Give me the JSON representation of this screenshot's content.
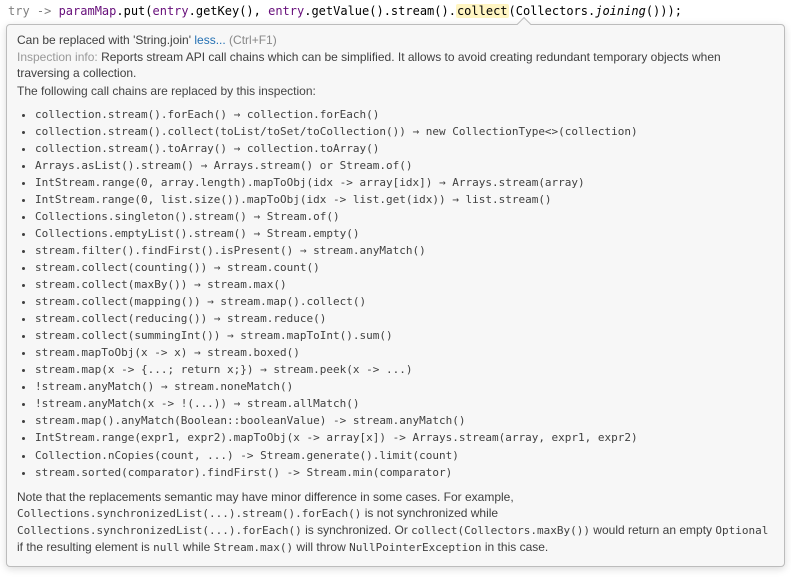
{
  "code": {
    "prefix": "try -> ",
    "paramMap": "paramMap",
    "put": ".put(",
    "entry1": "entry",
    "getKey": ".getKey(), ",
    "entry2": "entry",
    "getValue": ".getValue().stream().",
    "collect": "collect",
    "collectorsOpen": "(Collectors.",
    "joining": "joining",
    "close": "()));"
  },
  "tooltip": {
    "title": "Can be replaced with 'String.join'",
    "link": "less...",
    "shortcut": "(Ctrl+F1)",
    "inspection_label": "Inspection info:",
    "inspection_text": "Reports stream API call chains which can be simplified. It allows to avoid creating redundant temporary objects when traversing a collection.",
    "subhead": "The following call chains are replaced by this inspection:",
    "replacements": [
      "collection.stream().forEach() → collection.forEach()",
      "collection.stream().collect(toList/toSet/toCollection()) → new CollectionType<>(collection)",
      "collection.stream().toArray() → collection.toArray()",
      "Arrays.asList().stream() → Arrays.stream() or Stream.of()",
      "IntStream.range(0, array.length).mapToObj(idx -> array[idx]) → Arrays.stream(array)",
      "IntStream.range(0, list.size()).mapToObj(idx -> list.get(idx)) → list.stream()",
      "Collections.singleton().stream() → Stream.of()",
      "Collections.emptyList().stream() → Stream.empty()",
      "stream.filter().findFirst().isPresent() → stream.anyMatch()",
      "stream.collect(counting()) → stream.count()",
      "stream.collect(maxBy()) → stream.max()",
      "stream.collect(mapping()) → stream.map().collect()",
      "stream.collect(reducing()) → stream.reduce()",
      "stream.collect(summingInt()) → stream.mapToInt().sum()",
      "stream.mapToObj(x -> x) → stream.boxed()",
      "stream.map(x -> {...; return x;}) → stream.peek(x -> ...)",
      "!stream.anyMatch() → stream.noneMatch()",
      "!stream.anyMatch(x -> !(...)) → stream.allMatch()",
      "stream.map().anyMatch(Boolean::booleanValue) -> stream.anyMatch()",
      "IntStream.range(expr1, expr2).mapToObj(x -> array[x]) -> Arrays.stream(array, expr1, expr2)",
      "Collection.nCopies(count, ...) -> Stream.generate().limit(count)",
      "stream.sorted(comparator).findFirst() -> Stream.min(comparator)"
    ],
    "note_p1a": "Note that the replacements semantic may have minor difference in some cases. For example, ",
    "note_mono1": "Collections.synchronizedList(...).stream().forEach()",
    "note_p1b": " is not synchronized while ",
    "note_mono2": "Collections.synchronizedList(...).forEach()",
    "note_p1c": " is synchronized. Or ",
    "note_mono3": "collect(Collectors.maxBy())",
    "note_p1d": " would return an empty ",
    "note_mono4": "Optional",
    "note_p1e": " if the resulting element is ",
    "note_mono5": "null",
    "note_p1f": " while ",
    "note_mono6": "Stream.max()",
    "note_p1g": " will throw ",
    "note_mono7": "NullPointerException",
    "note_p1h": " in this case."
  }
}
